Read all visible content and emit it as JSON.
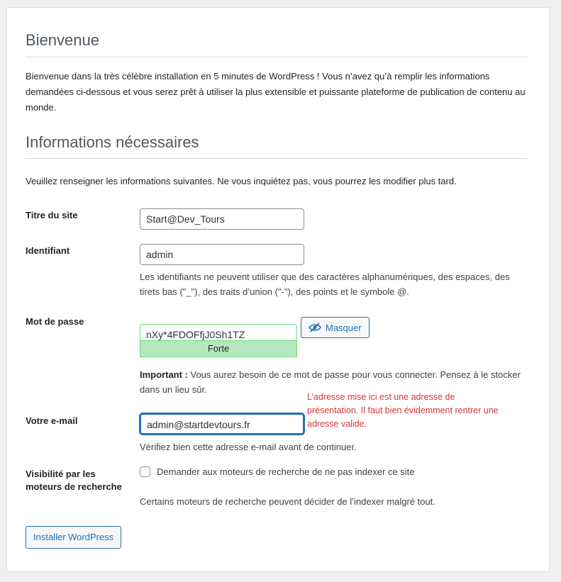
{
  "welcome": {
    "heading": "Bienvenue",
    "intro": "Bienvenue dans la très célèbre installation en 5 minutes de WordPress ! Vous n’avez qu’à remplir les informations demandées ci-dessous et vous serez prêt à utiliser la plus extensible et puissante plateforme de publication de contenu au monde."
  },
  "info": {
    "heading": "Informations nécessaires",
    "intro": "Veuillez renseigner les informations suivantes. Ne vous inquiétez pas, vous pourrez les modifier plus tard."
  },
  "form": {
    "site_title": {
      "label": "Titre du site",
      "value": "Start@Dev_Tours"
    },
    "username": {
      "label": "Identifiant",
      "value": "admin",
      "help": "Les identifiants ne peuvent utiliser que des caractères alphanumériques, des espaces, des tirets bas (\"_\"), des traits d’union (\"-\"), des points et le symbole @."
    },
    "password": {
      "label": "Mot de passe",
      "value": "nXy*4FDOFfjJ0Sh1TZ",
      "strength": "Forte",
      "hide_button": "Masquer",
      "hide_icon": "eye-slash-icon",
      "important_label": "Important :",
      "important_text": " Vous aurez besoin de ce mot de passe pour vous connecter. Pensez à le stocker dans un lieu sûr."
    },
    "email": {
      "label": "Votre e-mail",
      "value": "admin@startdevtours.fr",
      "help": "Vérifiez bien cette adresse e-mail avant de continuer.",
      "annotation": "L’adresse mise ici est une adresse de présentation. Il faut bien évidemment rentrer une adresse valide."
    },
    "visibility": {
      "label": "Visibilité par les moteurs de recherche",
      "checkbox_label": "Demander aux moteurs de recherche de ne pas indexer ce site",
      "checked": false,
      "help": "Certains moteurs de recherche peuvent décider de l’indexer malgré tout."
    }
  },
  "submit": {
    "label": "Installer WordPress"
  },
  "colors": {
    "accent": "#2271b1",
    "strength_bg": "#b8e6bf",
    "strength_border": "#68de7c",
    "annotation": "#d63638"
  }
}
